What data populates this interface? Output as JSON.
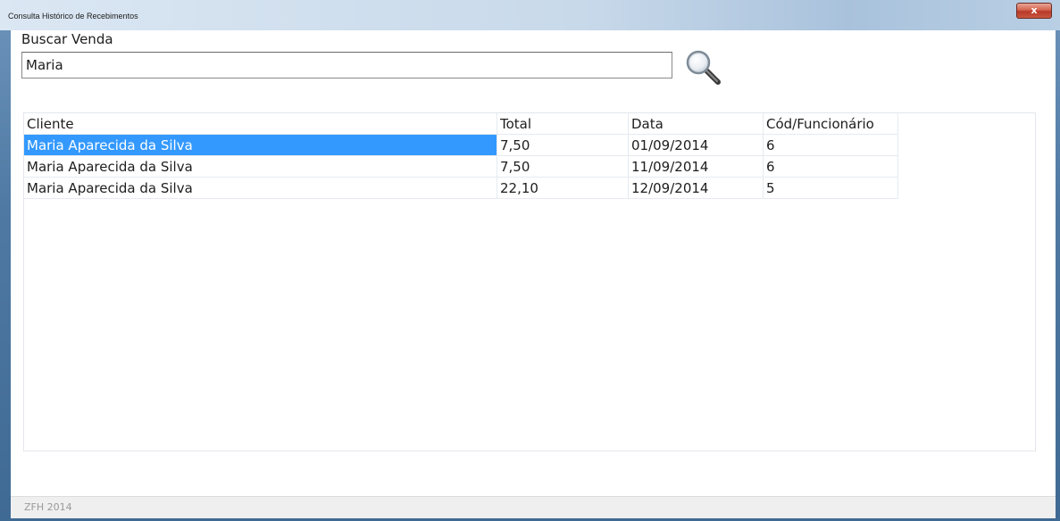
{
  "window": {
    "title": "Consulta Histórico de Recebimentos",
    "close_glyph": "x"
  },
  "search": {
    "label": "Buscar Venda",
    "value": "Maria",
    "icon": "magnifier-icon"
  },
  "table": {
    "columns": [
      "Cliente",
      "Total",
      "Data",
      "Cód/Funcionário"
    ],
    "rows": [
      [
        "Maria Aparecida da Silva",
        "7,50",
        "01/09/2014",
        "6"
      ],
      [
        "Maria Aparecida da Silva",
        "7,50",
        "11/09/2014",
        "6"
      ],
      [
        "Maria Aparecida da Silva",
        "22,10",
        "12/09/2014",
        "5"
      ]
    ],
    "selected_row": 0
  },
  "status": {
    "text": "ZFH 2014"
  },
  "colors": {
    "selection": "#3399ff",
    "window_frame": "#4f79a3",
    "close_button": "#c9563f"
  }
}
